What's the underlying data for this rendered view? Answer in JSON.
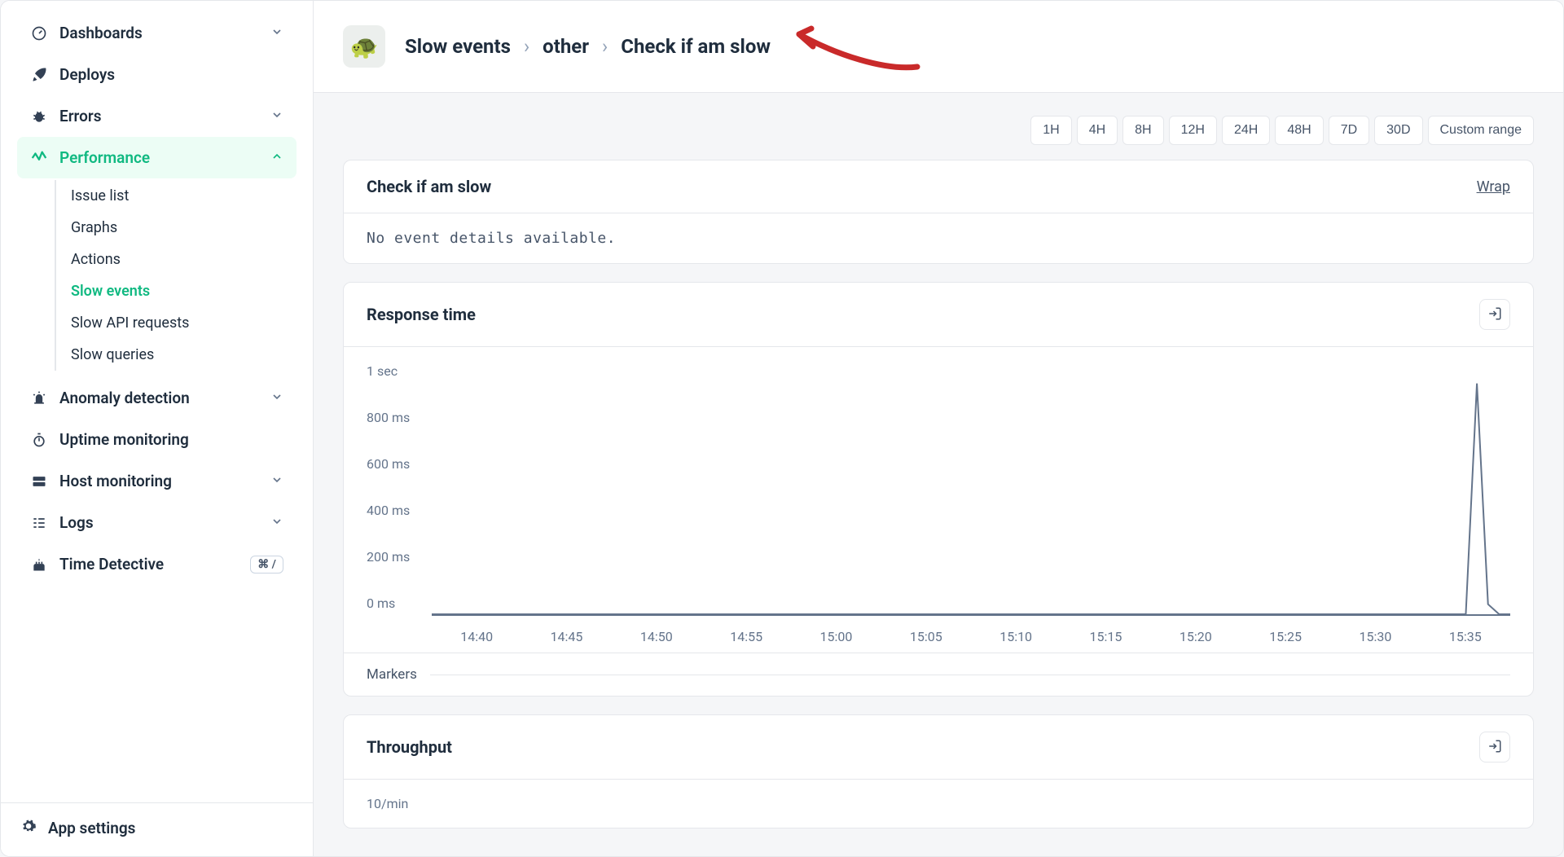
{
  "sidebar": {
    "items": [
      {
        "label": "Dashboards",
        "icon": "gauge",
        "expandable": true
      },
      {
        "label": "Deploys",
        "icon": "rocket",
        "expandable": false
      },
      {
        "label": "Errors",
        "icon": "bug",
        "expandable": true
      },
      {
        "label": "Performance",
        "icon": "perf",
        "expandable": true,
        "active": true
      },
      {
        "label": "Anomaly detection",
        "icon": "siren",
        "expandable": true
      },
      {
        "label": "Uptime monitoring",
        "icon": "stopwatch",
        "expandable": false
      },
      {
        "label": "Host monitoring",
        "icon": "server",
        "expandable": true
      },
      {
        "label": "Logs",
        "icon": "list",
        "expandable": true
      },
      {
        "label": "Time Detective",
        "icon": "birthday",
        "expandable": false,
        "shortcut": "⌘ /"
      }
    ],
    "performance_children": [
      {
        "label": "Issue list"
      },
      {
        "label": "Graphs"
      },
      {
        "label": "Actions"
      },
      {
        "label": "Slow events",
        "active": true
      },
      {
        "label": "Slow API requests"
      },
      {
        "label": "Slow queries"
      }
    ],
    "footer": {
      "label": "App settings",
      "icon": "gear"
    }
  },
  "breadcrumb": {
    "items": [
      "Slow events",
      "other",
      "Check if am slow"
    ],
    "sep": "›"
  },
  "ranges": [
    "1H",
    "4H",
    "8H",
    "12H",
    "24H",
    "48H",
    "7D",
    "30D",
    "Custom range"
  ],
  "event_card": {
    "title": "Check if am slow",
    "wrap": "Wrap",
    "body": "No event details available."
  },
  "response_card": {
    "title": "Response time",
    "markers_label": "Markers"
  },
  "throughput_card": {
    "title": "Throughput",
    "ytick": "10/min"
  },
  "colors": {
    "accent": "#10b981",
    "line": "#64748b",
    "arrow": "#c92a2a"
  },
  "chart_data": {
    "type": "line",
    "title": "Response time",
    "xlabel": "",
    "ylabel": "",
    "ylim": [
      0,
      1000
    ],
    "y_ticks": [
      "1 sec",
      "800 ms",
      "600 ms",
      "400 ms",
      "200 ms",
      "0 ms"
    ],
    "categories": [
      "14:40",
      "14:45",
      "14:50",
      "14:55",
      "15:00",
      "15:05",
      "15:10",
      "15:15",
      "15:20",
      "15:25",
      "15:30",
      "15:35"
    ],
    "values": [
      0,
      0,
      0,
      0,
      0,
      0,
      0,
      0,
      0,
      0,
      0,
      0,
      0,
      0,
      0,
      0,
      0,
      0,
      0,
      0,
      0,
      0,
      0,
      0,
      0,
      0,
      0,
      0,
      0,
      0,
      0,
      0,
      0,
      0,
      0,
      0,
      0,
      0,
      0,
      0,
      0,
      0,
      0,
      0,
      0,
      0,
      0,
      0,
      0,
      0,
      0,
      0,
      0,
      0,
      0,
      0,
      0,
      0,
      0,
      0,
      0,
      0,
      0,
      0,
      0,
      0,
      0,
      0,
      0,
      0,
      0,
      0,
      0,
      0,
      0,
      0,
      0,
      0,
      0,
      0,
      0,
      0,
      0,
      0,
      0,
      0,
      0,
      0,
      0,
      0,
      0,
      0,
      0,
      0,
      920,
      40,
      0,
      0
    ]
  }
}
